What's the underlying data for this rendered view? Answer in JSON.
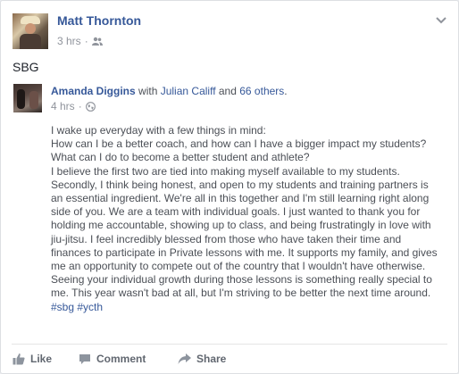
{
  "post": {
    "author": "Matt Thornton",
    "time": "3 hrs",
    "privacy_icon": "friends-icon",
    "text": "SBG"
  },
  "shared": {
    "author": "Amanda Diggins",
    "with_label": "with",
    "tagged": "Julian Califf",
    "and_label": "and",
    "others": "66 others",
    "period": ".",
    "time": "4 hrs",
    "privacy_icon": "globe-icon",
    "body": "I wake up everyday with a few things in mind:\nHow can I be a better coach, and how can I have a bigger impact my students?\nWhat can I do to become a better student and athlete?\nI believe the first two are tied into making myself available to my students.\nSecondly, I think being honest, and open to my students and training partners is\nan essential ingredient. We're all in this together and I'm still learning right along\nside of you. We are a team with individual goals. I just wanted to thank you for\nholding me accountable, showing up to class, and being frustratingly in love with\njiu-jitsu. I feel incredibly blessed from those who have taken their time and\nfinances to participate in Private lessons with me. It supports my family, and gives\nme an opportunity to compete out of the country that I wouldn't have otherwise.\nSeeing your individual growth during those lessons is something really special to\nme. This year wasn't bad at all, but I'm striving to be better the next time around.",
    "hashtags": "#sbg #ycth"
  },
  "actions": {
    "like": "Like",
    "comment": "Comment",
    "share": "Share"
  },
  "colors": {
    "link": "#365899",
    "meta": "#90949c",
    "body": "#4b4f56"
  }
}
